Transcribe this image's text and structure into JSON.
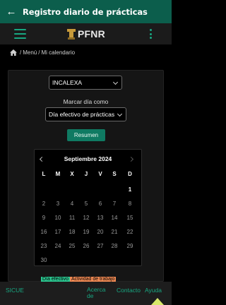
{
  "appbar": {
    "title": "Registro diario de prácticas"
  },
  "topbar": {
    "logo_text": "PFNR"
  },
  "breadcrumb": {
    "menu": "Menú",
    "calendar": "Mi calendario",
    "separator": "/"
  },
  "form": {
    "company_value": "INCALEXA",
    "mark_label": "Marcar día como",
    "day_type_value": "Día efectivo de prácticas",
    "resumen_label": "Resumen"
  },
  "calendar": {
    "month_title": "Septiembre 2024",
    "weekdays": [
      "L",
      "M",
      "X",
      "J",
      "V",
      "S",
      "D"
    ],
    "days": [
      "1",
      "2",
      "3",
      "4",
      "5",
      "6",
      "7",
      "8",
      "9",
      "10",
      "11",
      "12",
      "13",
      "14",
      "15",
      "16",
      "17",
      "18",
      "19",
      "20",
      "21",
      "22",
      "23",
      "24",
      "25",
      "26",
      "27",
      "28",
      "29",
      "30"
    ],
    "first_weekday_index": 6
  },
  "legend": {
    "effective": "Día efectivo",
    "other": "Actividad de trabajo"
  },
  "bottombar": {
    "sicue": "SICUE",
    "acerca": "Acerca de",
    "contacto": "Contacto",
    "ayuda": "Ayuda"
  },
  "colors": {
    "appbar": "#0c5e4c",
    "accent": "#18a882",
    "button": "#0f7a62",
    "legend_effective": "#2bc58f",
    "legend_other": "#f08a54"
  }
}
